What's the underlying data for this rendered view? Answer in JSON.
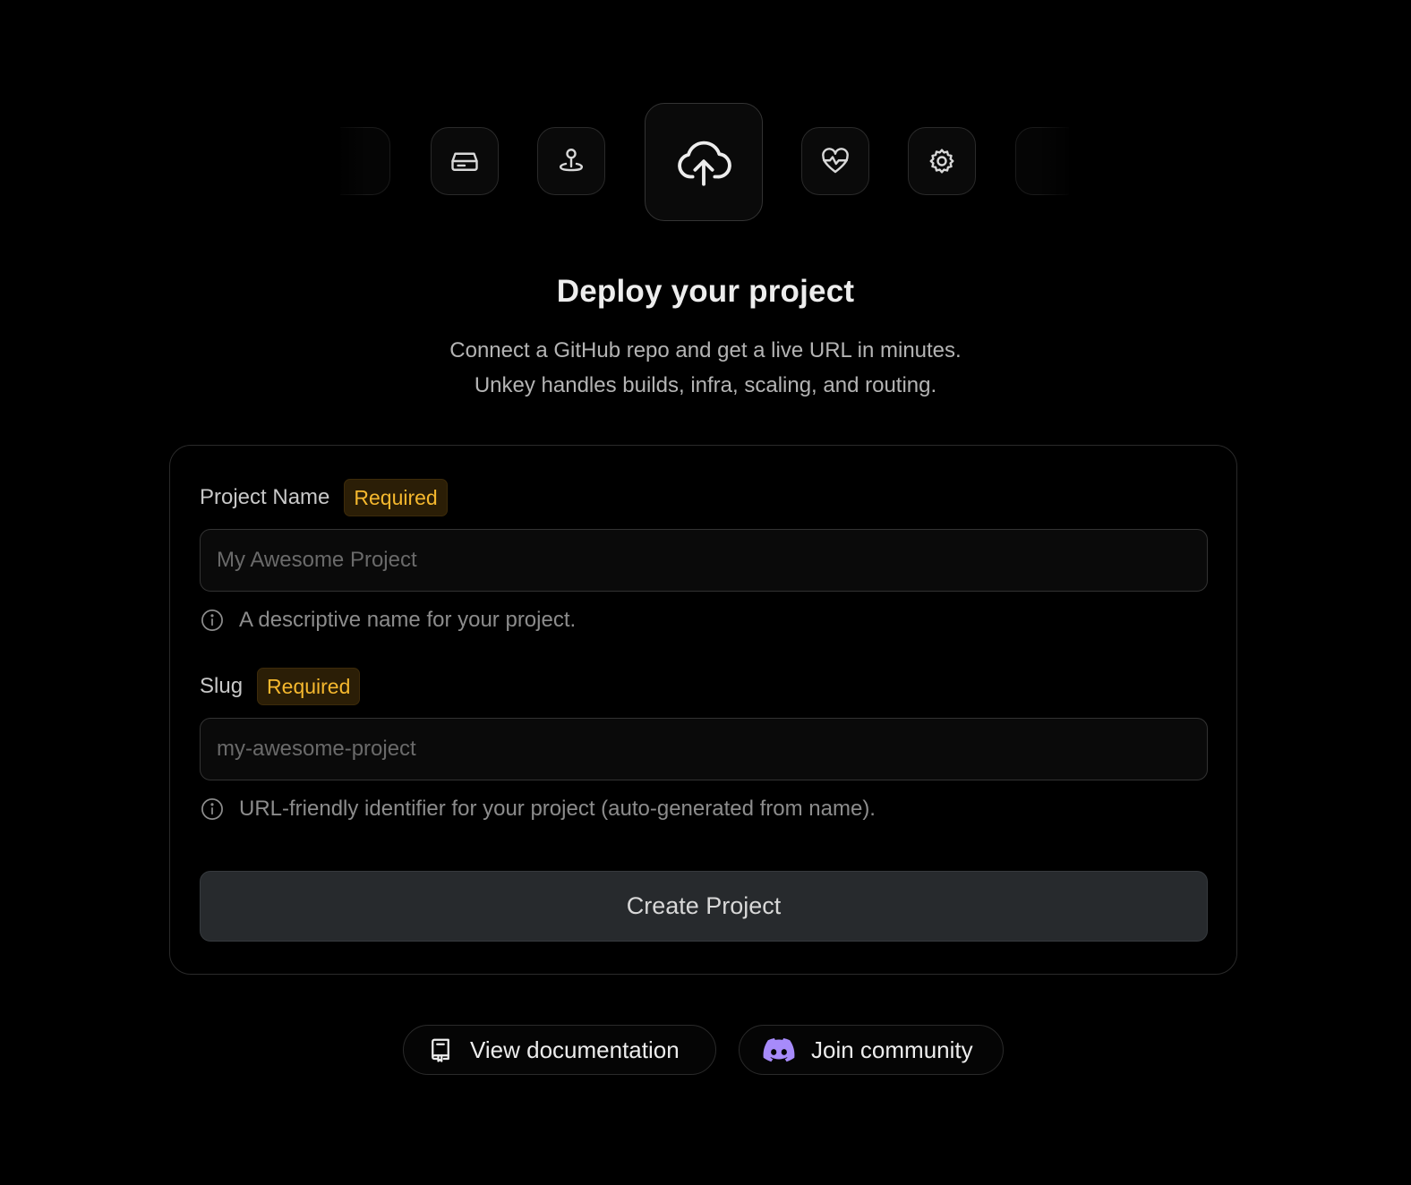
{
  "hero": {
    "icons": [
      "partial-tile-icon",
      "drive-icon",
      "map-pin-icon",
      "cloud-upload-icon",
      "heart-pulse-icon",
      "gear-icon",
      "partial-tile-icon"
    ],
    "title": "Deploy your project",
    "subtitle_line1": "Connect a GitHub repo and get a live URL in minutes.",
    "subtitle_line2": "Unkey handles builds, infra, scaling, and routing."
  },
  "form": {
    "project_name": {
      "label": "Project Name",
      "badge": "Required",
      "placeholder": "My Awesome Project",
      "value": "",
      "help": "A descriptive name for your project."
    },
    "slug": {
      "label": "Slug",
      "badge": "Required",
      "placeholder": "my-awesome-project",
      "value": "",
      "help": "URL-friendly identifier for your project (auto-generated from name)."
    },
    "submit_label": "Create Project"
  },
  "footer": {
    "docs_label": "View documentation",
    "community_label": "Join community"
  },
  "colors": {
    "background": "#000000",
    "badge_text": "#f5b82e",
    "badge_bg": "#2b1e06",
    "discord": "#a78bfa"
  }
}
